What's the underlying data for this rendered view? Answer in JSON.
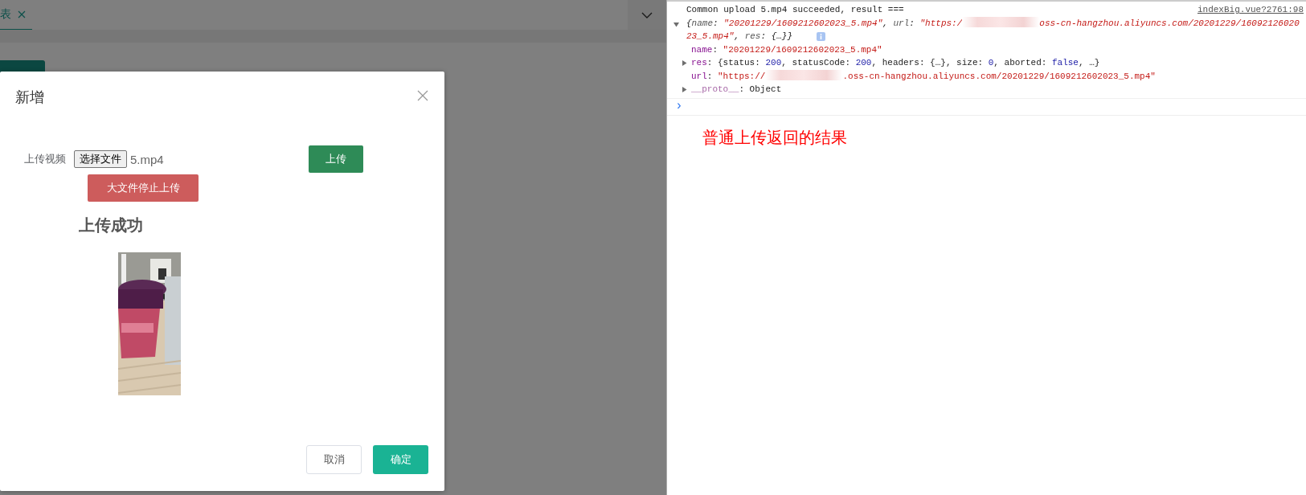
{
  "app": {
    "tabs": [
      {
        "label": "表",
        "selected": true
      }
    ]
  },
  "dialog": {
    "title": "新增",
    "field_label": "上传视频",
    "file_button": "选择文件",
    "file_name": "5.mp4",
    "upload_button": "上传",
    "stop_button": "大文件停止上传",
    "status": "上传成功",
    "cancel_button": "取消",
    "confirm_button": "确定"
  },
  "console": {
    "messages": [
      {
        "text": "Common upload 5.mp4 succeeded, result ===",
        "source": "indexBig.vue?2761:98",
        "object": {
          "expanded": true,
          "preview": [
            {
              "kind": "text",
              "text": "{"
            },
            {
              "kind": "key",
              "text": "name"
            },
            {
              "kind": "text",
              "text": ": "
            },
            {
              "kind": "string",
              "text": "\"20201229/1609212602023_5.mp4\""
            },
            {
              "kind": "text",
              "text": ", "
            },
            {
              "kind": "key",
              "text": "url"
            },
            {
              "kind": "text",
              "text": ": "
            },
            {
              "kind": "string",
              "text": "\"https:/"
            },
            {
              "kind": "redacted"
            },
            {
              "kind": "string",
              "text": "oss-cn-hangzhou.aliyuncs.com/20201229/1609212602023_5.mp4\""
            },
            {
              "kind": "text",
              "text": ", "
            },
            {
              "kind": "key",
              "text": "res"
            },
            {
              "kind": "text",
              "text": ": {…}}"
            }
          ],
          "properties": [
            {
              "kind": "leaf",
              "key": "name",
              "value": [
                {
                  "kind": "text",
                  "text": ": "
                },
                {
                  "kind": "string",
                  "text": "\"20201229/1609212602023_5.mp4\""
                }
              ]
            },
            {
              "kind": "collapsed",
              "key": "res",
              "value": [
                {
                  "kind": "text",
                  "text": ": {status: "
                },
                {
                  "kind": "number",
                  "text": "200"
                },
                {
                  "kind": "text",
                  "text": ", statusCode: "
                },
                {
                  "kind": "number",
                  "text": "200"
                },
                {
                  "kind": "text",
                  "text": ", headers: {…}, size: "
                },
                {
                  "kind": "number",
                  "text": "0"
                },
                {
                  "kind": "text",
                  "text": ", aborted: "
                },
                {
                  "kind": "number",
                  "text": "false"
                },
                {
                  "kind": "text",
                  "text": ", …}"
                }
              ]
            },
            {
              "kind": "leaf",
              "key": "url",
              "value": [
                {
                  "kind": "text",
                  "text": ": "
                },
                {
                  "kind": "string",
                  "text": "\"https://"
                },
                {
                  "kind": "redacted"
                },
                {
                  "kind": "string",
                  "text": ".oss-cn-hangzhou.aliyuncs.com/20201229/1609212602023_5.mp4\""
                }
              ]
            },
            {
              "kind": "collapsed",
              "key": "__proto__",
              "value": [
                {
                  "kind": "text",
                  "text": ": Object"
                }
              ]
            }
          ]
        }
      }
    ],
    "prompt": "›"
  },
  "annotation": "普通上传返回的结果"
}
